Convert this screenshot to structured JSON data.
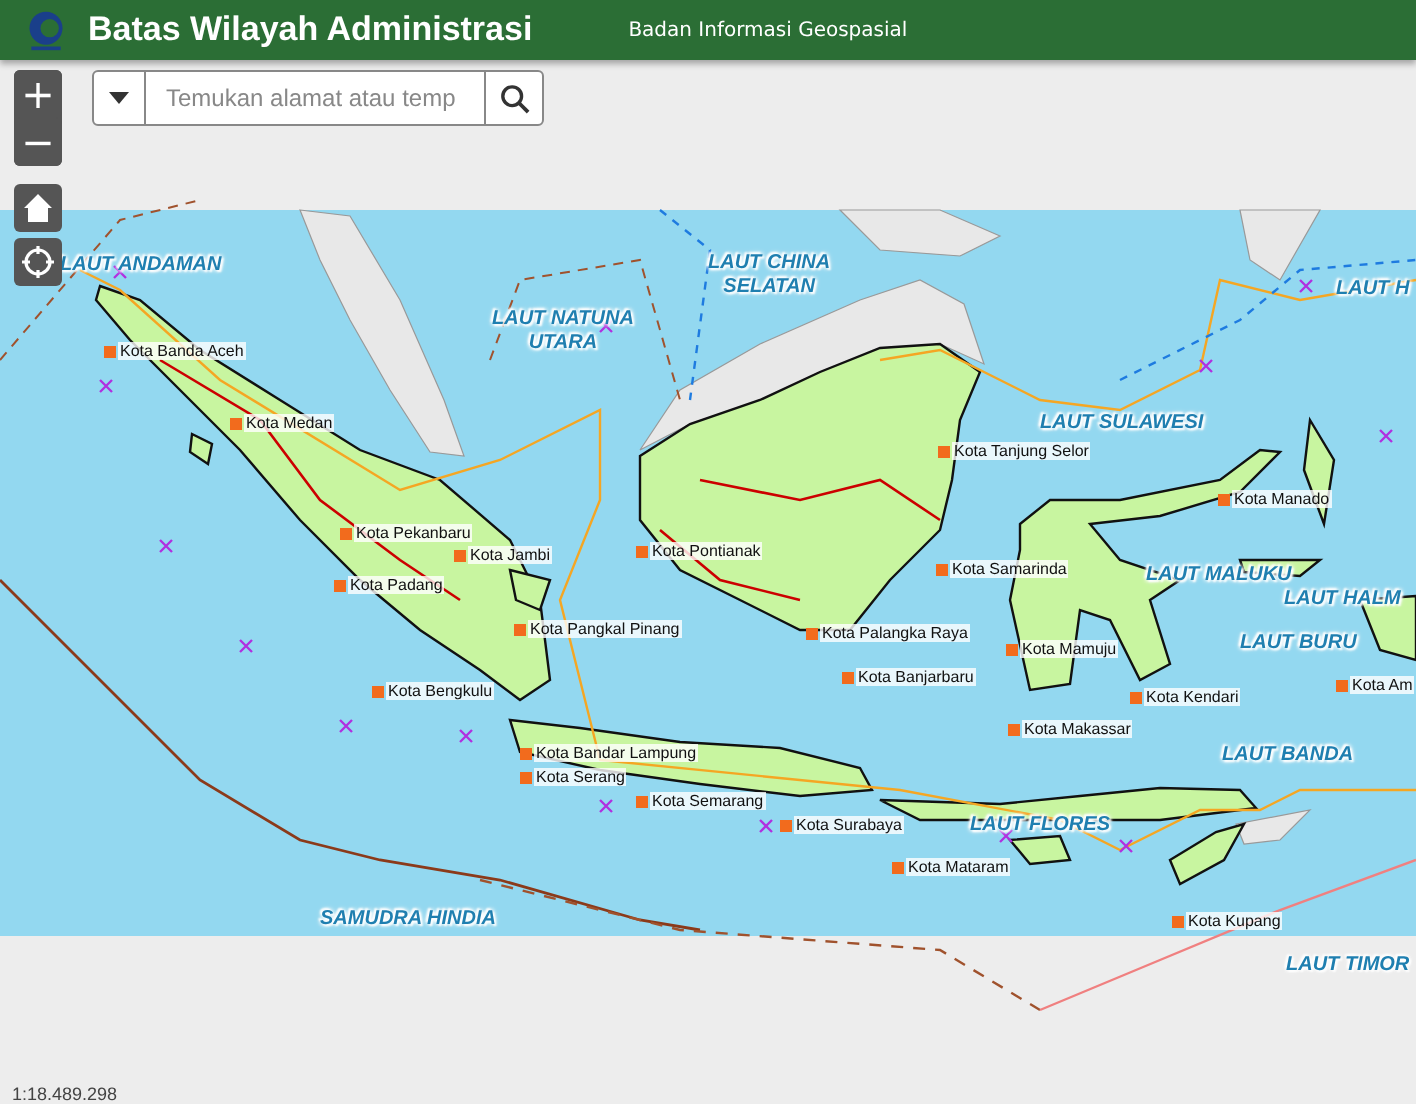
{
  "header": {
    "title": "Batas Wilayah Administrasi",
    "subtitle": "Badan Informasi Geospasial"
  },
  "zoom": {
    "zoom_in": "+",
    "zoom_out": "−"
  },
  "search": {
    "placeholder": "Temukan alamat atau temp"
  },
  "map": {
    "sea_labels": [
      {
        "lines": [
          "LAUT ANDAMAN"
        ]
      },
      {
        "lines": [
          "LAUT CHINA",
          "SELATAN"
        ]
      },
      {
        "lines": [
          "LAUT NATUNA",
          "UTARA"
        ]
      },
      {
        "lines": [
          "LAUT H"
        ]
      },
      {
        "lines": [
          "LAUT SULAWESI"
        ]
      },
      {
        "lines": [
          "LAUT MALUKU"
        ]
      },
      {
        "lines": [
          "LAUT HALM"
        ]
      },
      {
        "lines": [
          "LAUT BURU"
        ]
      },
      {
        "lines": [
          "LAUT BANDA"
        ]
      },
      {
        "lines": [
          "LAUT FLORES"
        ]
      },
      {
        "lines": [
          "LAUT TIMOR"
        ]
      },
      {
        "lines": [
          "SAMUDRA HINDIA"
        ]
      }
    ],
    "city_labels": [
      "Kota Banda Aceh",
      "Kota Medan",
      "Kota Pekanbaru",
      "Kota Padang",
      "Kota Jambi",
      "Kota Pangkal Pinang",
      "Kota Bengkulu",
      "Kota Bandar Lampung",
      "Kota Serang",
      "Kota Semarang",
      "Kota Surabaya",
      "Kota Mataram",
      "Kota Pontianak",
      "Kota Tanjung Selor",
      "Kota Samarinda",
      "Kota Palangka Raya",
      "Kota Banjarbaru",
      "Kota Mamuju",
      "Kota Makassar",
      "Kota Kendari",
      "Kota Manado",
      "Kota Am",
      "Kota Kupang"
    ]
  },
  "scale": "1:18.489.298"
}
